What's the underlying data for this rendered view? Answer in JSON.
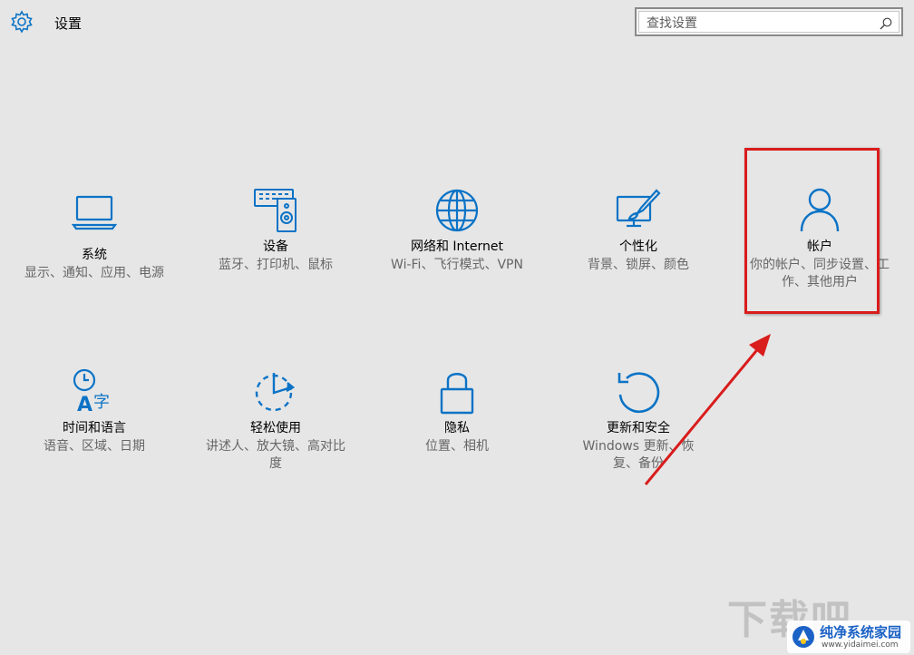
{
  "header": {
    "title": "设置"
  },
  "search": {
    "placeholder": "查找设置",
    "value": ""
  },
  "tiles": [
    {
      "label": "系统",
      "desc": "显示、通知、应用、电源",
      "icon": "laptop-icon"
    },
    {
      "label": "设备",
      "desc": "蓝牙、打印机、鼠标",
      "icon": "devices-icon"
    },
    {
      "label": "网络和 Internet",
      "desc": "Wi-Fi、飞行模式、VPN",
      "icon": "globe-icon"
    },
    {
      "label": "个性化",
      "desc": "背景、锁屏、颜色",
      "icon": "personalization-icon"
    },
    {
      "label": "帐户",
      "desc": "你的帐户、同步设置、工作、其他用户",
      "icon": "person-icon"
    },
    {
      "label": "时间和语言",
      "desc": "语音、区域、日期",
      "icon": "time-language-icon"
    },
    {
      "label": "轻松使用",
      "desc": "讲述人、放大镜、高对比度",
      "icon": "ease-of-access-icon"
    },
    {
      "label": "隐私",
      "desc": "位置、相机",
      "icon": "lock-icon"
    },
    {
      "label": "更新和安全",
      "desc": "Windows 更新、恢复、备份",
      "icon": "update-icon"
    }
  ],
  "annotation": {
    "highlighted_tile": "帐户",
    "border_color": "#d91c1c",
    "arrow_color": "#d91c1c"
  },
  "watermark": {
    "big_text": "下载吧",
    "name": "纯净系统家园",
    "url": "www.yidaimei.com"
  },
  "colors": {
    "accent": "#0b73c6",
    "background": "#e6e6e6",
    "secondary_text": "#666666"
  }
}
